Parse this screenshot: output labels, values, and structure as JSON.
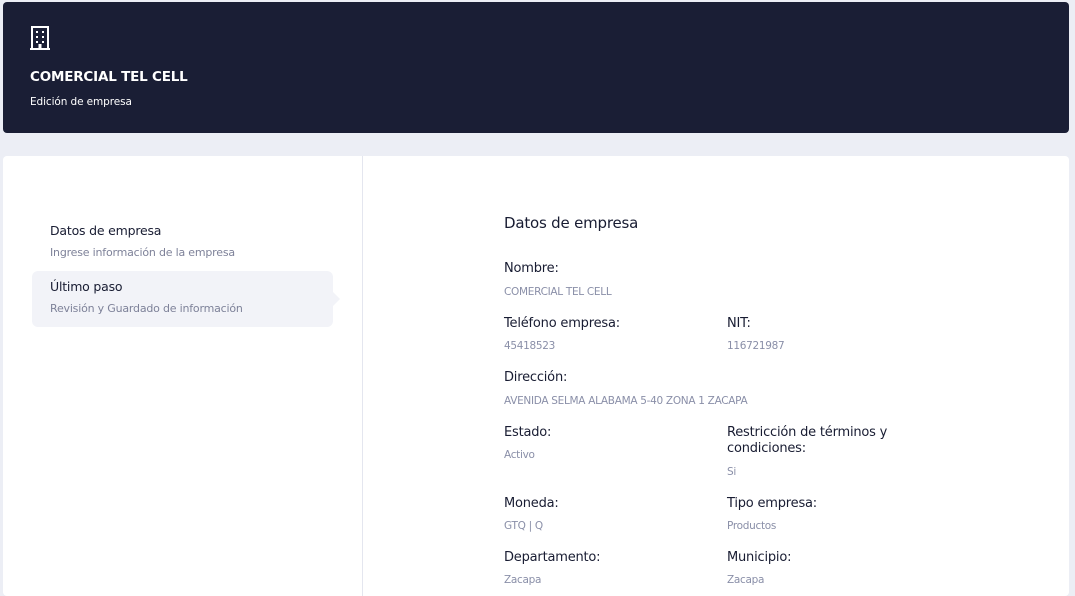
{
  "header": {
    "icon": "building-icon",
    "title": "COMERCIAL TEL CELL",
    "subtitle": "Edición de empresa"
  },
  "stepper": {
    "steps": [
      {
        "title": "Datos de empresa",
        "description": "Ingrese información de la empresa"
      },
      {
        "title": "Último paso",
        "description": "Revisión y Guardado de información"
      }
    ]
  },
  "details": {
    "section_title": "Datos de empresa",
    "fields": {
      "nombre": {
        "label": "Nombre:",
        "value": "COMERCIAL TEL CELL"
      },
      "telefono": {
        "label": "Teléfono empresa:",
        "value": "45418523"
      },
      "nit": {
        "label": "NIT:",
        "value": "116721987"
      },
      "direccion": {
        "label": "Dirección:",
        "value": "AVENIDA SELMA ALABAMA 5-40 ZONA 1 ZACAPA"
      },
      "estado": {
        "label": "Estado:",
        "value": "Activo"
      },
      "restriccion_line1": {
        "label": "Restricción de términos y"
      },
      "restriccion_line2": {
        "label": "condiciones:",
        "value": "Si"
      },
      "moneda": {
        "label": "Moneda:",
        "value": "GTQ | Q"
      },
      "tipo": {
        "label": "Tipo empresa:",
        "value": "Productos"
      },
      "departamento": {
        "label": "Departamento:",
        "value": "Zacapa"
      },
      "municipio": {
        "label": "Municipio:",
        "value": "Zacapa"
      }
    }
  }
}
